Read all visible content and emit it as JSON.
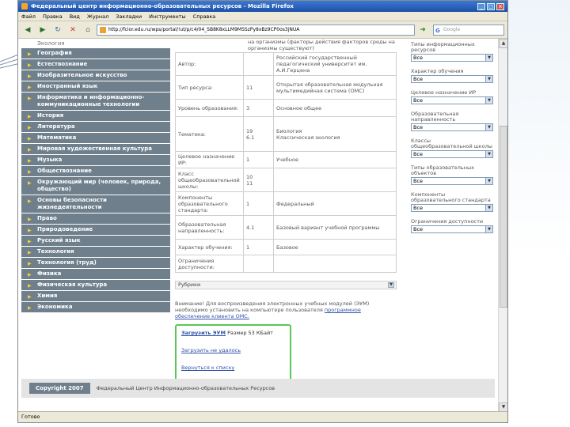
{
  "window": {
    "title": "Федеральный центр информационно-образовательных ресурсов - Mozilla Firefox"
  },
  "menu": [
    "Файл",
    "Правка",
    "Вид",
    "Журнал",
    "Закладки",
    "Инструменты",
    "Справка"
  ],
  "address": {
    "url": "http://fcior.edu.ru/wps/portal/!ut/p/c4/04_SB8K8xLLM9MSSzPy8xBz9CP0os3jNUA",
    "search_placeholder": "Google"
  },
  "sidebar": {
    "first": "Экология",
    "items": [
      "География",
      "Естествознание",
      "Изобразительное искусство",
      "Иностранный язык",
      "Информатика и информационно-коммуникационные технологии",
      "История",
      "Литература",
      "Математика",
      "Мировая художественная культура",
      "Музыка",
      "Обществознание",
      "Окружающий мир (человек, природа, общество)",
      "Основы безопасности жизнедеятельности",
      "Право",
      "Природоведение",
      "Русский язык",
      "Технология",
      "Технология (труд)",
      "Физика",
      "Физическая культура",
      "Химия",
      "Экономика"
    ]
  },
  "content": {
    "top_note": "на организмы (факторы действия факторов среды на организмы существуют)",
    "rows": [
      {
        "label": "Автор:",
        "code": "",
        "value": "Российский государственный педагогический университет им. А.И.Герцена"
      },
      {
        "label": "Тип ресурса:",
        "code": "11",
        "value": "Открытая образовательная модульная мультимедийная система (ОМС)"
      },
      {
        "label": "Уровень образования:",
        "code": "3",
        "value": "Основное общее"
      },
      {
        "label": "Тематика:",
        "code": "19\n6.1",
        "value": "Биология\nКлассическая экология"
      },
      {
        "label": "Целевое назначение ИР:",
        "code": "1",
        "value": "Учебное"
      },
      {
        "label": "Класс общеобразовательной школы:",
        "code": "10\n11",
        "value": ""
      },
      {
        "label": "Компоненты образовательного стандарта:",
        "code": "1",
        "value": "Федеральный"
      },
      {
        "label": "Образовательная направленность:",
        "code": "4.1",
        "value": "Базовый вариант учебной программы"
      },
      {
        "label": "Характер обучения:",
        "code": "1",
        "value": "Базовое"
      },
      {
        "label": "Ограничения доступности:",
        "code": "",
        "value": ""
      }
    ],
    "rubrics_label": "Рубрики",
    "notice_text": "Внимание! Для воспроизведения электронных учебных модулей (ЭУМ) необходимо установить на компьютере пользователя",
    "notice_link": "программное обеспечение клиента ОМС.",
    "download_link": "Загрузить ЭУМ",
    "download_size": "Размер 53 КБайт",
    "missing_link": "Загрузить не удалось",
    "back_link": "Вернуться к списку"
  },
  "filters": [
    {
      "label": "Типы информационных ресурсов",
      "value": "Все"
    },
    {
      "label": "Характер обучения",
      "value": "Все"
    },
    {
      "label": "Целевое назначение ИР",
      "value": "Все"
    },
    {
      "label": "Образовательная направленность",
      "value": "Все"
    },
    {
      "label": "Классы общеобразовательной школы",
      "value": "Все"
    },
    {
      "label": "Типы образовательных объектов",
      "value": "Все"
    },
    {
      "label": "Компоненты образовательного стандарта",
      "value": "Все"
    },
    {
      "label": "Ограничения доступности",
      "value": "Все"
    }
  ],
  "footer": {
    "copyright": "Copyright 2007",
    "org": "Федеральный Центр Информационно-образовательных Ресурсов"
  },
  "status": "Готово"
}
